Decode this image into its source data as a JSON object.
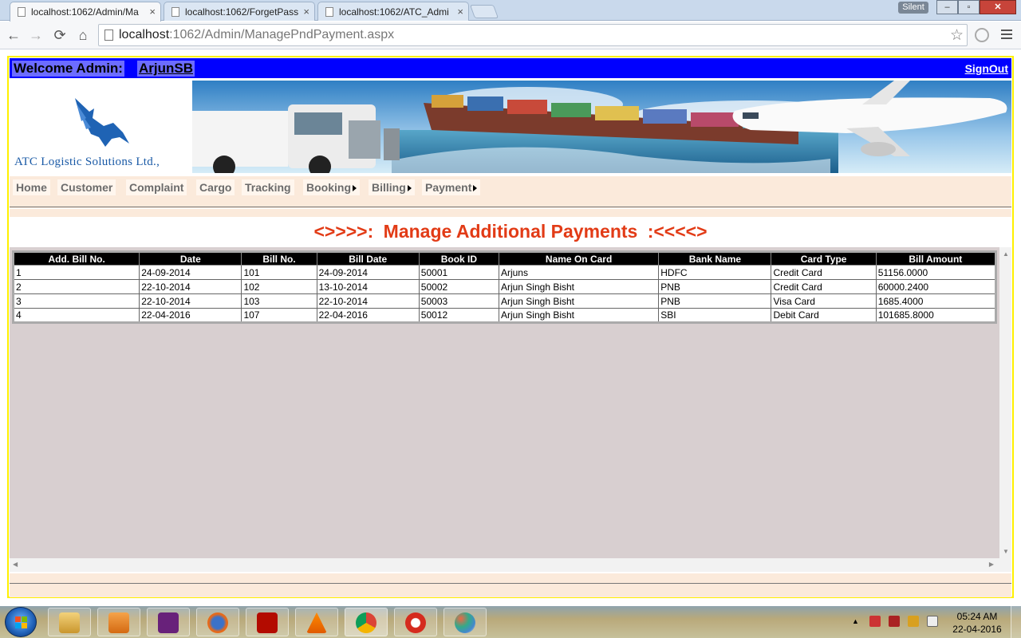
{
  "browser": {
    "tabs": [
      {
        "title": "localhost:1062/Admin/Ma",
        "active": true
      },
      {
        "title": "localhost:1062/ForgetPass",
        "active": false
      },
      {
        "title": "localhost:1062/ATC_Admi",
        "active": false
      }
    ],
    "tab_close": "×",
    "silent_label": "Silent",
    "window_controls": {
      "minimize": "–",
      "restore": "▫",
      "close": "✕"
    },
    "address": {
      "host": "localhost",
      "path": ":1062/Admin/ManagePndPayment.aspx"
    },
    "nav": {
      "back": "←",
      "forward": "→",
      "reload": "⟳",
      "home": "⌂",
      "bookmark": "☆"
    }
  },
  "header": {
    "welcome_label": "Welcome Admin:",
    "username": "ArjunSB",
    "signout_label": "SignOut",
    "logo_text": "ATC Logistic Solutions Ltd.,"
  },
  "menu": {
    "items": [
      {
        "label": "Home",
        "has_submenu": false
      },
      {
        "label": "Customer",
        "has_submenu": false
      },
      {
        "label": "Complaint",
        "has_submenu": false
      },
      {
        "label": "Cargo",
        "has_submenu": false
      },
      {
        "label": "Tracking",
        "has_submenu": false
      },
      {
        "label": "Booking",
        "has_submenu": true
      },
      {
        "label": "Billing",
        "has_submenu": true
      },
      {
        "label": "Payment",
        "has_submenu": true
      }
    ]
  },
  "page": {
    "heading_left": "<>>>>:",
    "heading_title": "Manage Additional Payments",
    "heading_right": ":<<<<>"
  },
  "table": {
    "columns": [
      "Add. Bill No.",
      "Date",
      "Bill No.",
      "Bill Date",
      "Book ID",
      "Name On Card",
      "Bank Name",
      "Card Type",
      "Bill Amount"
    ],
    "rows": [
      [
        "1",
        "24-09-2014",
        "101",
        "24-09-2014",
        "50001",
        "Arjuns",
        "HDFC",
        "Credit Card",
        "51156.0000"
      ],
      [
        "2",
        "22-10-2014",
        "102",
        "13-10-2014",
        "50002",
        "Arjun Singh Bisht",
        "PNB",
        "Credit Card",
        "60000.2400"
      ],
      [
        "3",
        "22-10-2014",
        "103",
        "22-10-2014",
        "50003",
        "Arjun Singh Bisht",
        "PNB",
        "Visa Card",
        "1685.4000"
      ],
      [
        "4",
        "22-04-2016",
        "107",
        "22-04-2016",
        "50012",
        "Arjun Singh Bisht",
        "SBI",
        "Debit Card",
        "101685.8000"
      ]
    ]
  },
  "taskbar": {
    "apps": [
      "file-explorer",
      "media-player",
      "visual-studio",
      "firefox",
      "acrobat-reader",
      "vlc",
      "chrome",
      "ccleaner",
      "paint"
    ],
    "clock_time": "05:24 AM",
    "clock_date": "22-04-2016"
  }
}
